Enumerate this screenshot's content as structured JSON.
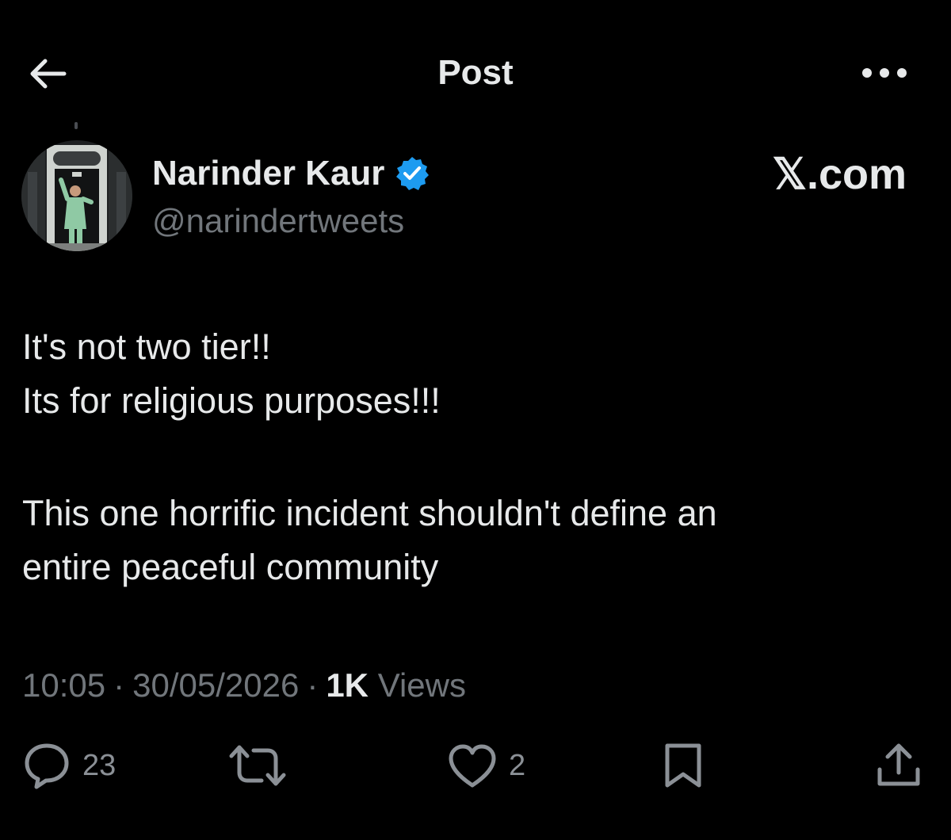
{
  "header": {
    "title": "Post"
  },
  "author": {
    "name": "Narinder Kaur",
    "handle": "@narindertweets",
    "verified": true,
    "verified_color": "#1d9bf0"
  },
  "watermark": "𝕏.com",
  "post": {
    "lines": [
      "It's not two tier!!",
      "Its for religious purposes!!!",
      "This one horrific incident shouldn't define an",
      "entire peaceful community"
    ]
  },
  "meta": {
    "time": "10:05",
    "date": "30/05/2026",
    "views_count": "1K",
    "views_label": "Views"
  },
  "actions": {
    "reply_count": "23",
    "like_count": "2"
  },
  "icons": {
    "back": "arrow-left-icon",
    "more": "more-dots-icon",
    "reply": "reply-bubble-icon",
    "repost": "repost-icon",
    "like": "heart-icon",
    "bookmark": "bookmark-icon",
    "share": "share-icon"
  },
  "colors": {
    "background": "#000000",
    "text": "#e7e9ea",
    "muted": "#71767b"
  }
}
